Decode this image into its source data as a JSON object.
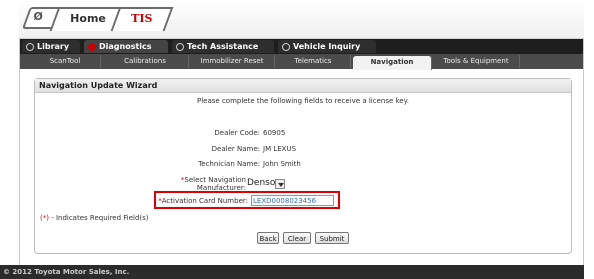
{
  "header": {
    "logo_glyph": "Ø",
    "home_tab": "Home",
    "tis_tab": "TIS"
  },
  "categories": [
    {
      "label": "Library"
    },
    {
      "label": "Diagnostics"
    },
    {
      "label": "Tech Assistance"
    },
    {
      "label": "Vehicle Inquiry"
    }
  ],
  "subtabs": [
    {
      "label": "ScanTool"
    },
    {
      "label": "Calibrations"
    },
    {
      "label": "Immobilizer Reset"
    },
    {
      "label": "Telematics"
    },
    {
      "label": "Navigation"
    },
    {
      "label": "Tools & Equipment"
    }
  ],
  "panel": {
    "title": "Navigation Update Wizard",
    "instructions": "Please complete the following fields to receive a license key."
  },
  "form": {
    "dealer_code_label": "Dealer Code:",
    "dealer_code_value": "60905",
    "dealer_name_label": "Dealer Name:",
    "dealer_name_value": "JM LEXUS",
    "technician_label": "Technician Name:",
    "technician_value": "John Smith",
    "manufacturer_label_1": "Select Navigation",
    "manufacturer_label_2": "Manufacturer:",
    "manufacturer_value": "Denso",
    "activation_label": "Activation Card Number:",
    "activation_value": "LEXD0008023456",
    "required_marker": "*"
  },
  "note": {
    "marker": "(*)",
    "text": " - Indicates Required Field(s)"
  },
  "buttons": {
    "back": "Back",
    "clear": "Clear",
    "submit": "Submit"
  },
  "footer": "© 2012 Toyota Motor Sales, Inc.",
  "colors": {
    "required": "#cc0000",
    "highlight": "#e00000",
    "input_text": "#3a6fb0"
  }
}
